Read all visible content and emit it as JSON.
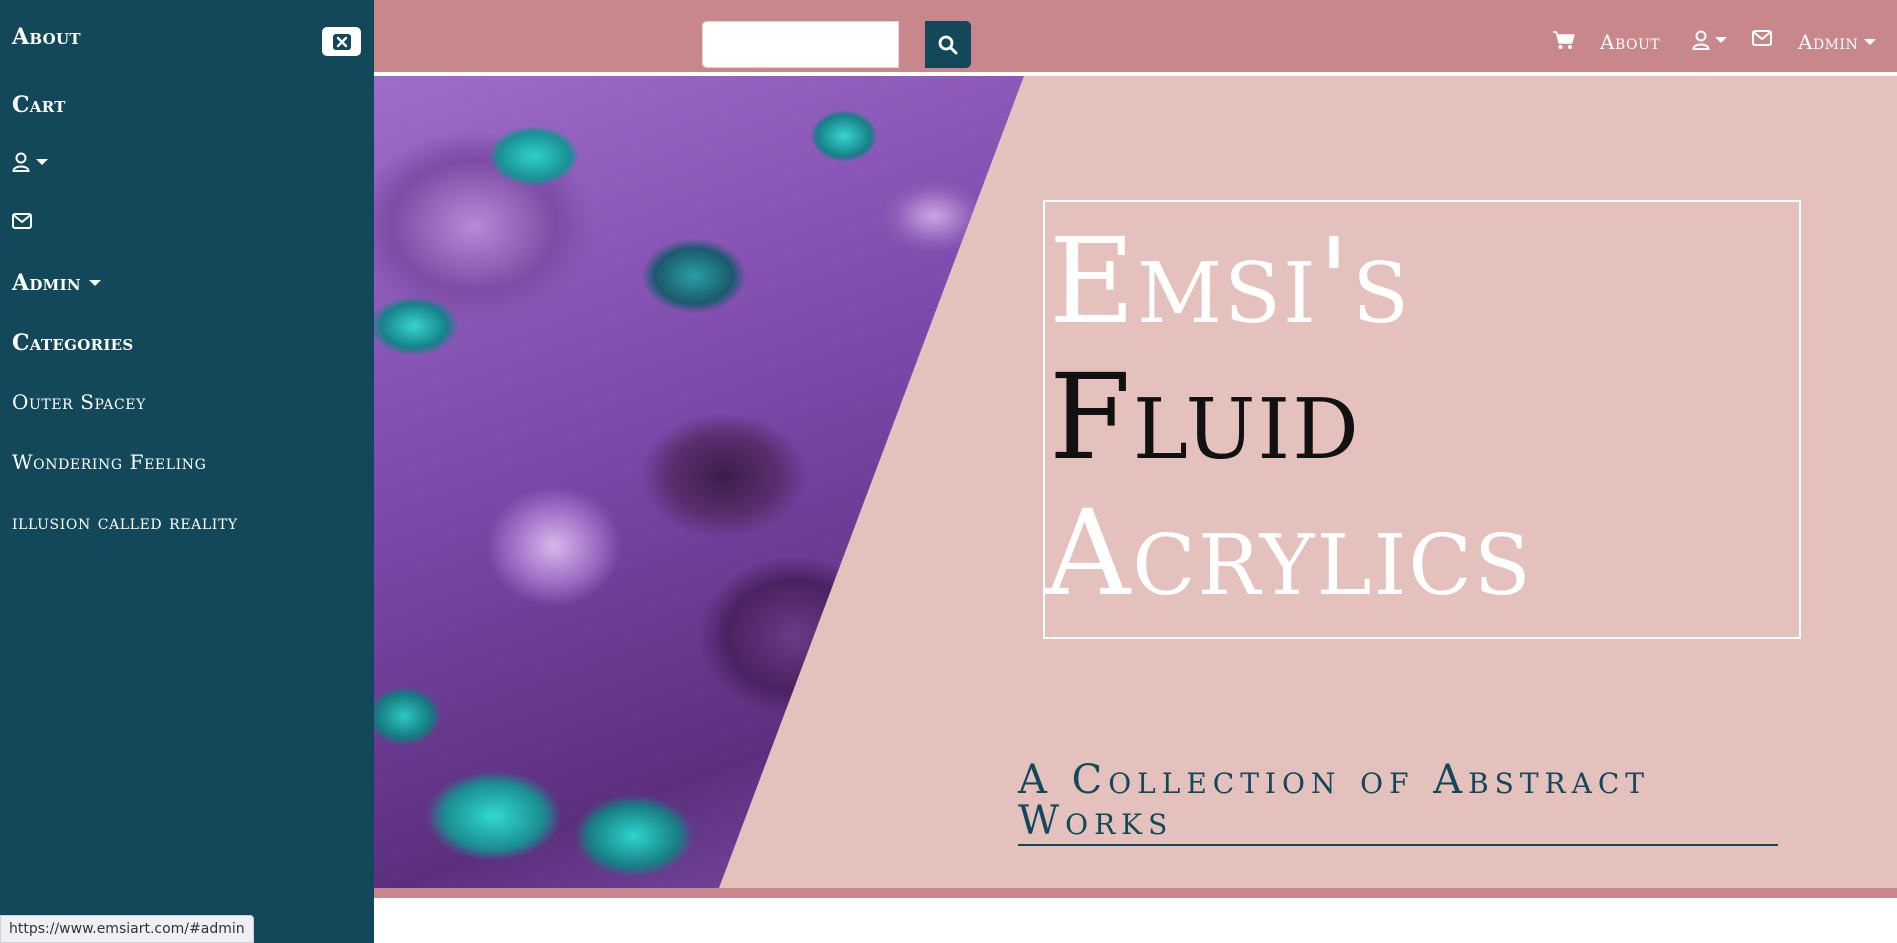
{
  "sidebar": {
    "about_label": "About",
    "cart_label": "Cart",
    "admin_label": "Admin",
    "categories_label": "Categories",
    "categories": [
      "Outer Spacey",
      "Wondering Feeling",
      "illusion called reality"
    ]
  },
  "header": {
    "search": {
      "placeholder": "",
      "value": ""
    },
    "about_label": "About",
    "admin_label": "Admin"
  },
  "hero": {
    "title_lines": [
      "Emsi's",
      "Fluid",
      "Acrylics"
    ],
    "subtitle": "A Collection of Abstract Works"
  },
  "status_bar": {
    "url": "https://www.emsiart.com/#admin"
  },
  "colors": {
    "sidebar_bg": "#13485a",
    "header_bg": "#c8878a",
    "hero_bg": "#e4c1bd",
    "accent_dark": "#13485a",
    "white": "#ffffff"
  },
  "icons": {
    "close": "close-icon",
    "user": "user-icon",
    "mail": "mail-icon",
    "cart": "cart-icon",
    "search": "search-icon",
    "caret": "caret-down-icon"
  }
}
